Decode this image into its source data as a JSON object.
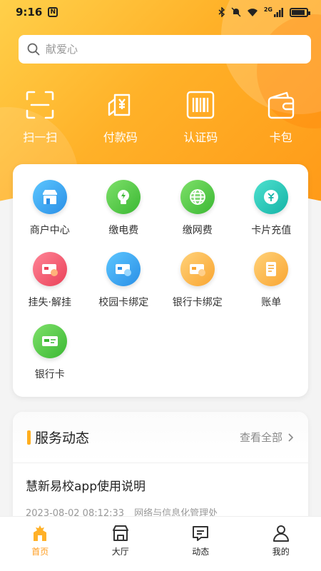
{
  "status_bar": {
    "time": "9:16",
    "network": "2G"
  },
  "search": {
    "placeholder": "献爱心"
  },
  "quick_actions": [
    {
      "label": "扫一扫",
      "icon": "scan-icon"
    },
    {
      "label": "付款码",
      "icon": "payment-code-icon"
    },
    {
      "label": "认证码",
      "icon": "barcode-icon"
    },
    {
      "label": "卡包",
      "icon": "wallet-icon"
    }
  ],
  "services": [
    {
      "label": "商户中心",
      "icon": "shop-icon",
      "color": "#2fa9ef"
    },
    {
      "label": "缴电费",
      "icon": "bulb-icon",
      "color": "#47c83c"
    },
    {
      "label": "缴网费",
      "icon": "globe-icon",
      "color": "#47c83c"
    },
    {
      "label": "卡片充值",
      "icon": "recharge-icon",
      "color": "#1fc9b7"
    },
    {
      "label": "挂失·解挂",
      "icon": "card-lock-icon",
      "color": "#f25a6e"
    },
    {
      "label": "校园卡绑定",
      "icon": "campus-card-icon",
      "color": "#2fa9ef"
    },
    {
      "label": "银行卡绑定",
      "icon": "bank-card-bind-icon",
      "color": "#fbb13c"
    },
    {
      "label": "账单",
      "icon": "bill-icon",
      "color": "#fbb13c"
    },
    {
      "label": "银行卡",
      "icon": "bank-card-icon",
      "color": "#47c83c"
    }
  ],
  "news": {
    "title": "服务动态",
    "more": "查看全部",
    "item": {
      "title": "慧新易校app使用说明",
      "date": "2023-08-02 08:12:33",
      "source": "网络与信息化管理处"
    }
  },
  "tabs": [
    {
      "label": "首页",
      "icon": "home-icon",
      "active": true
    },
    {
      "label": "大厅",
      "icon": "hall-icon",
      "active": false
    },
    {
      "label": "动态",
      "icon": "message-icon",
      "active": false
    },
    {
      "label": "我的",
      "icon": "profile-icon",
      "active": false
    }
  ],
  "colors": {
    "accent": "#ff9a18",
    "hero_start": "#ffd04a",
    "hero_end": "#ff9a18"
  }
}
